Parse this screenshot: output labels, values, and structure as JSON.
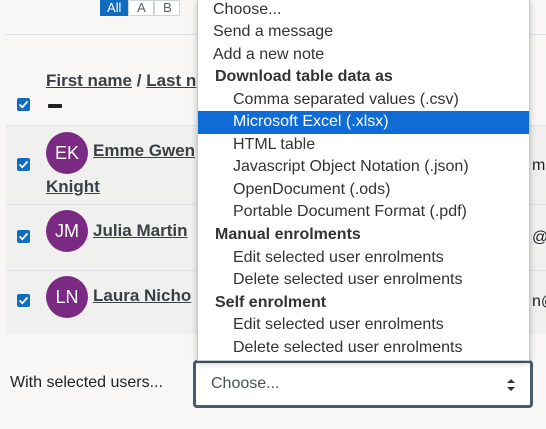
{
  "letter_filter": {
    "items": [
      "All",
      "A",
      "B"
    ],
    "active": "All"
  },
  "table": {
    "header": {
      "first_name": "First name",
      "separator": "/",
      "last_name_partial": "Last n"
    },
    "rows": [
      {
        "initials": "EK",
        "name_line1": "Emme Gwen",
        "name_line2": "Knight",
        "email_partial": "ma"
      },
      {
        "initials": "JM",
        "name": "Julia Martin",
        "email_partial": "@n"
      },
      {
        "initials": "LN",
        "name": "Laura Nicho",
        "email_partial": "n@"
      }
    ]
  },
  "bulk": {
    "label": "With selected users...",
    "select_value": "Choose...",
    "options": [
      {
        "label": "Choose...",
        "kind": "top"
      },
      {
        "label": "Send a message",
        "kind": "top"
      },
      {
        "label": "Add a new note",
        "kind": "top"
      },
      {
        "label": "Download table data as",
        "kind": "group"
      },
      {
        "label": "Comma separated values (.csv)",
        "kind": "item"
      },
      {
        "label": "Microsoft Excel (.xlsx)",
        "kind": "item",
        "selected": true
      },
      {
        "label": "HTML table",
        "kind": "item"
      },
      {
        "label": "Javascript Object Notation (.json)",
        "kind": "item"
      },
      {
        "label": "OpenDocument (.ods)",
        "kind": "item"
      },
      {
        "label": "Portable Document Format (.pdf)",
        "kind": "item"
      },
      {
        "label": "Manual enrolments",
        "kind": "group"
      },
      {
        "label": "Edit selected user enrolments",
        "kind": "item"
      },
      {
        "label": "Delete selected user enrolments",
        "kind": "item"
      },
      {
        "label": "Self enrolment",
        "kind": "group"
      },
      {
        "label": "Edit selected user enrolments",
        "kind": "item"
      },
      {
        "label": "Delete selected user enrolments",
        "kind": "item"
      }
    ]
  },
  "colors": {
    "accent": "#0f6cbf",
    "avatar": "#7b2a83",
    "highlight": "#0f6cd6",
    "select_border": "#475c70"
  }
}
